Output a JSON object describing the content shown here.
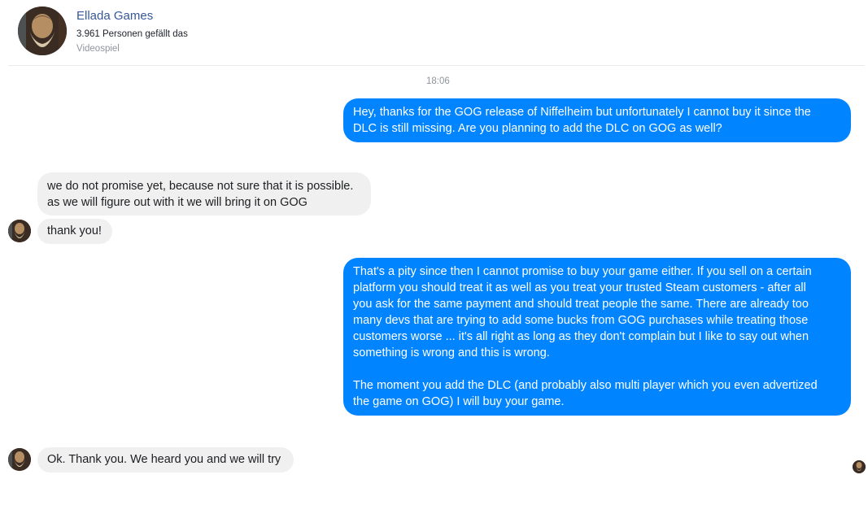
{
  "header": {
    "page_name": "Ellada Games",
    "likes": "3.961 Personen gefällt das",
    "category": "Videospiel",
    "avatar_icon": "bearded-warrior-avatar-icon"
  },
  "timestamp": "18:06",
  "messages": [
    {
      "sender": "user",
      "text": "Hey, thanks for the GOG release of Niffelheim but unfortunately I cannot buy it since the\nDLC is still missing. Are you planning to add the DLC on GOG as well?"
    },
    {
      "sender": "page",
      "text": "we do not promise yet, because not sure that it is possible.\nas we will figure out with it we will bring it on GOG"
    },
    {
      "sender": "page",
      "text": "thank you!"
    },
    {
      "sender": "user",
      "text": "That's a pity since then I cannot promise to buy your game either. If you sell on a certain\nplatform you should treat it as well as you treat your trusted Steam customers - after all\nyou ask for the same payment and should treat people the same. There are already too\nmany devs that are trying to add some bucks from GOG purchases while treating those\ncustomers worse ... it's all right as long as they don't complain but I like to say out when\nsomething is wrong and this is wrong.\n\nThe moment you add the DLC (and probably also multi player which you even advertized\nthe game on GOG) I will buy your game."
    },
    {
      "sender": "page",
      "text": "Ok. Thank you. We heard you and we will try"
    }
  ],
  "colors": {
    "outgoing_bubble": "#0084ff",
    "incoming_bubble": "#f1f0f0",
    "page_name": "#365899",
    "muted_text": "#90949c"
  }
}
